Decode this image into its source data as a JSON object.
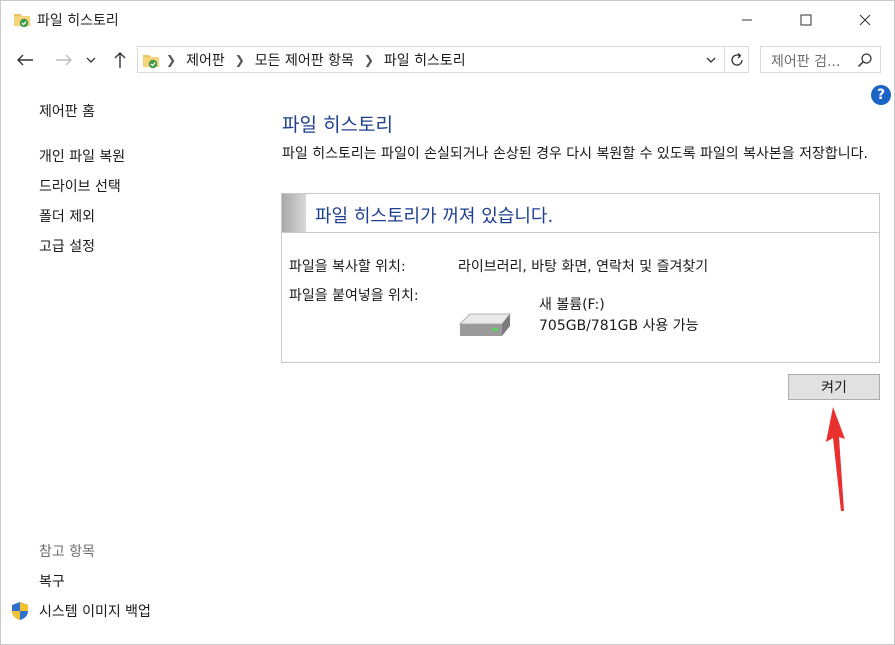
{
  "window": {
    "title": "파일 히스토리"
  },
  "address": {
    "crumbs": [
      "제어판",
      "모든 제어판 항목",
      "파일 히스토리"
    ],
    "search_placeholder": "제어판 검..."
  },
  "left_nav": {
    "home": "제어판 홈",
    "links": [
      "개인 파일 복원",
      "드라이브 선택",
      "폴더 제외",
      "고급 설정"
    ],
    "see_also_header": "참고 항목",
    "see_also": [
      "복구",
      "시스템 이미지 백업"
    ]
  },
  "help_label": "?",
  "main": {
    "title": "파일 히스토리",
    "description": "파일 히스토리는 파일이 손실되거나 손상된 경우 다시 복원할 수 있도록 파일의 복사본을 저장합니다.",
    "status": "파일 히스토리가 꺼져 있습니다.",
    "copy_from_label": "파일을 복사할 위치:",
    "copy_from_value": "라이브러리, 바탕 화면, 연락처 및 즐겨찾기",
    "copy_to_label": "파일을 붙여넣을 위치:",
    "drive_name": "새 볼륨(F:)",
    "drive_space": "705GB/781GB 사용 가능",
    "turn_on_button": "켜기"
  },
  "colors": {
    "link_title": "#1e3f8f",
    "help": "#1b64c6",
    "annotation_arrow": "#e8312f"
  }
}
